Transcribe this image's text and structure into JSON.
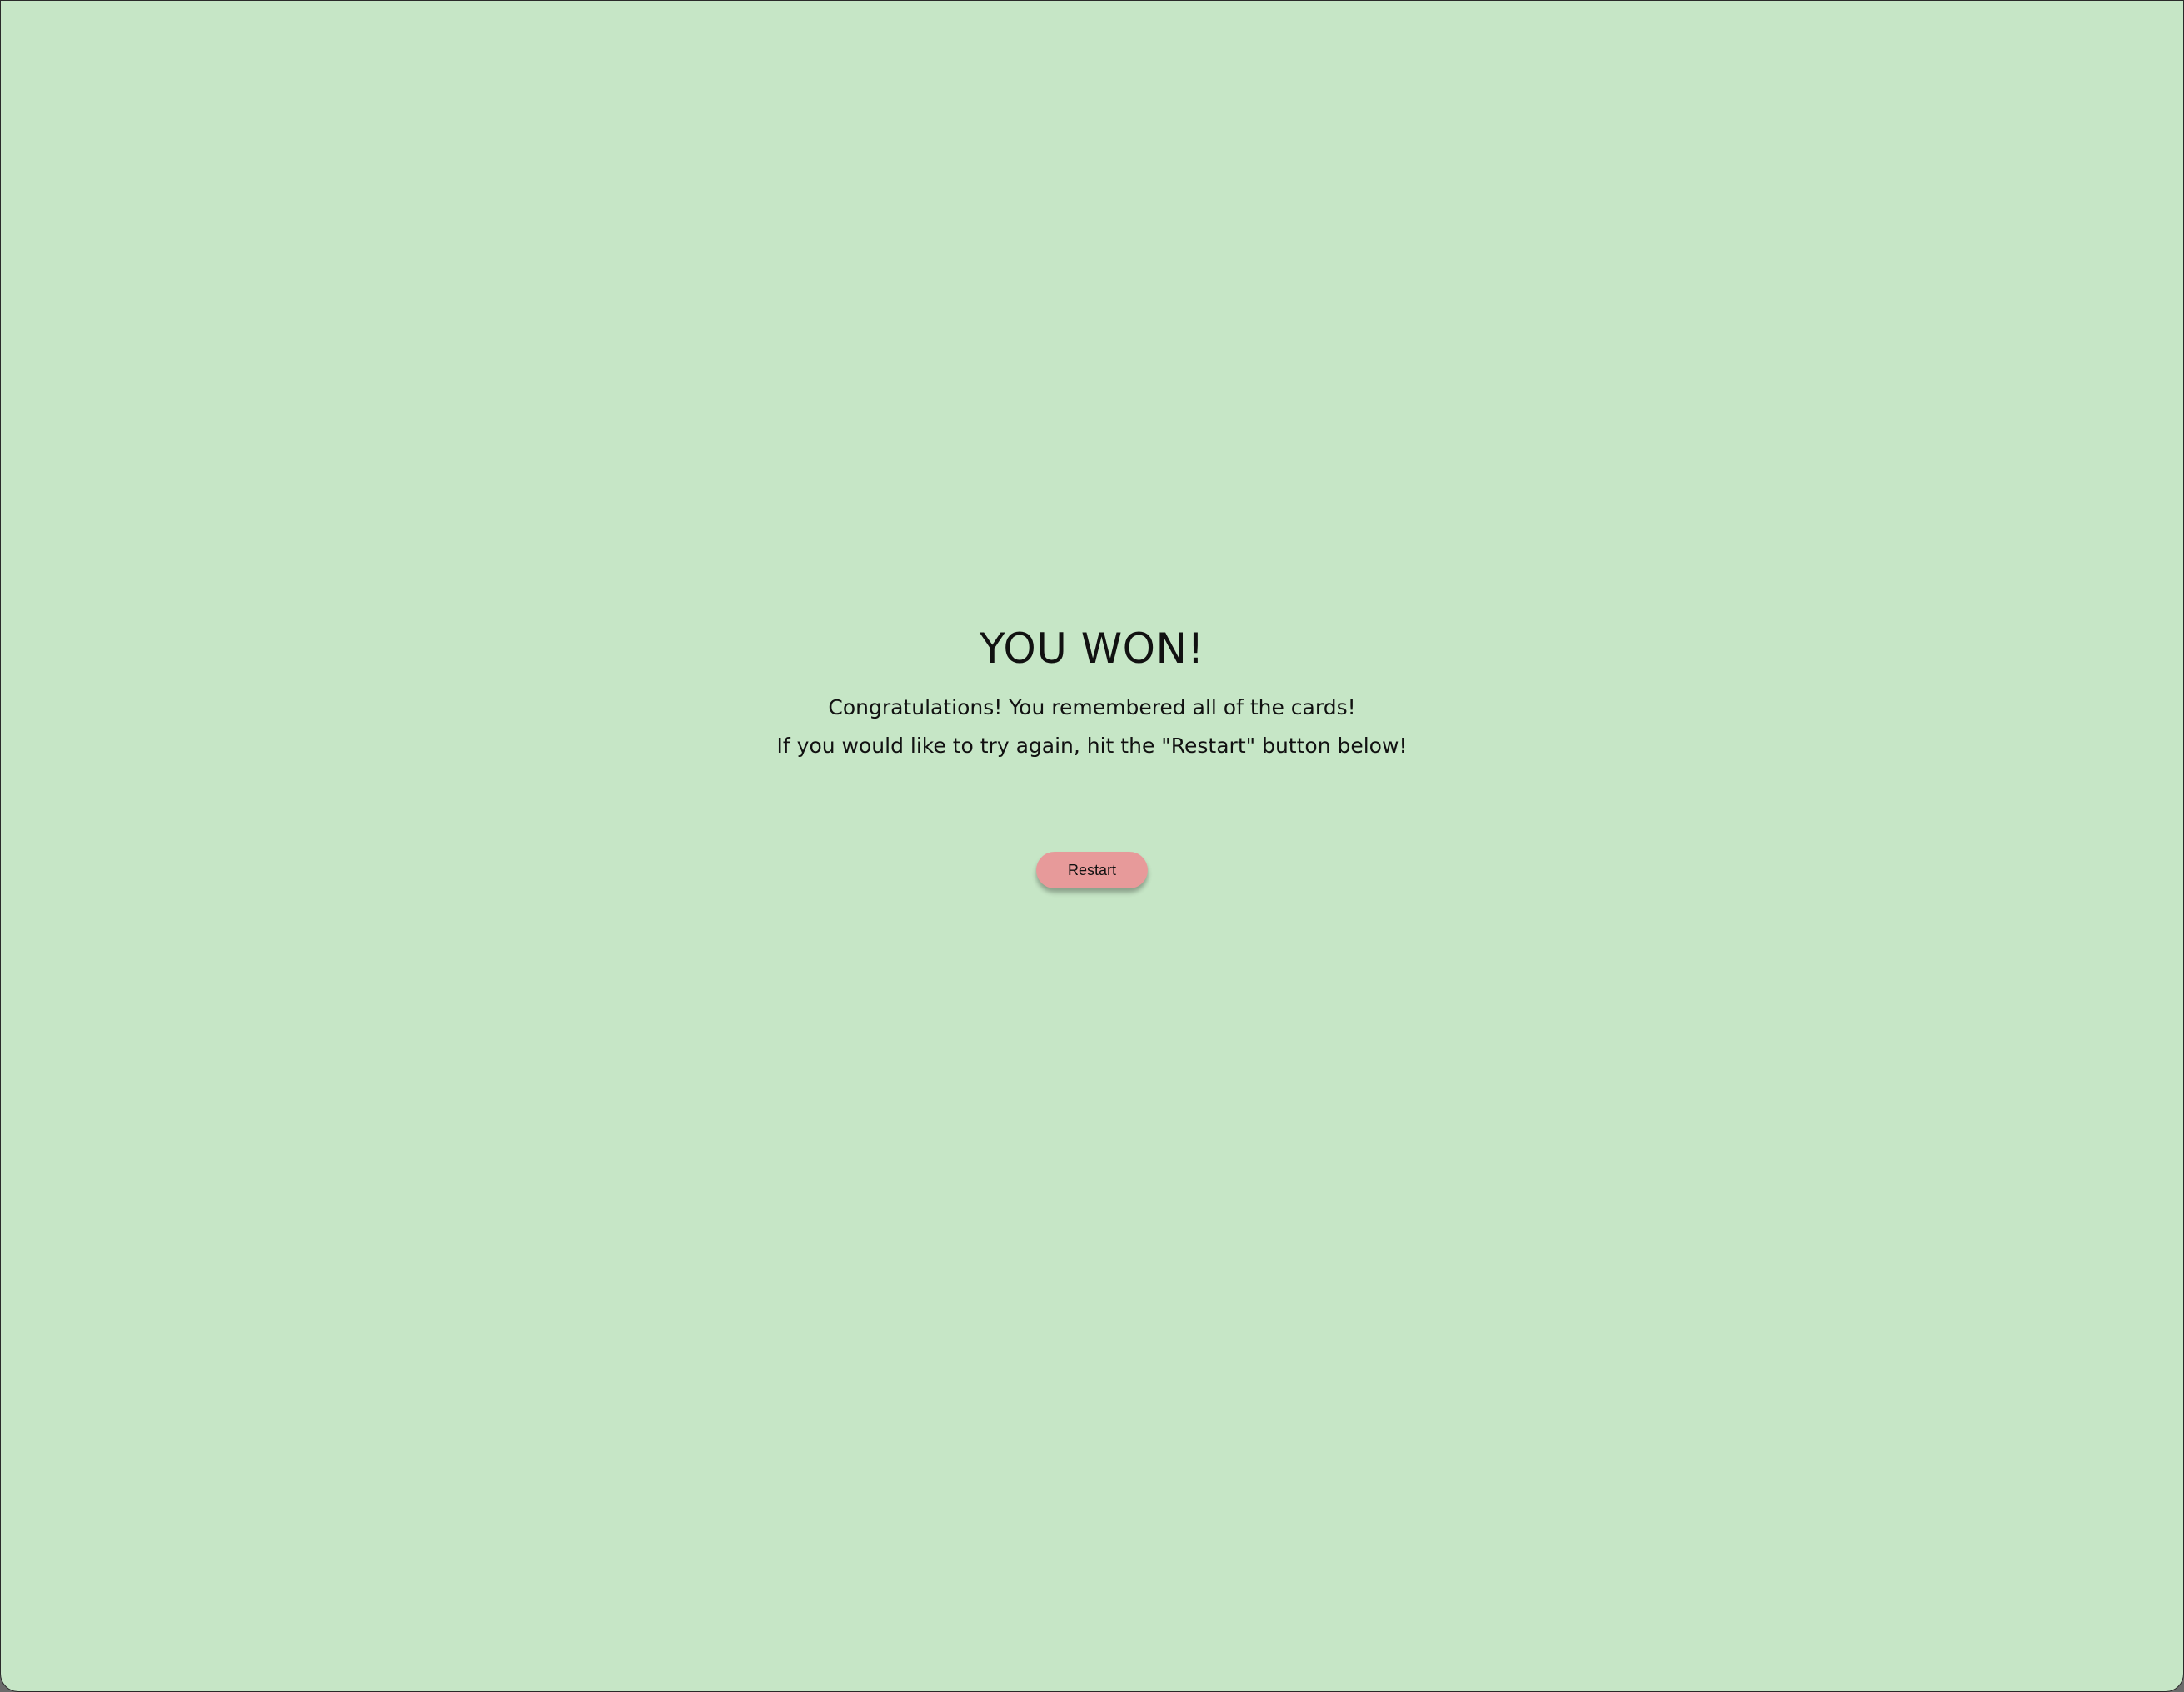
{
  "result": {
    "title": "YOU WON!",
    "message_line1": "Congratulations! You remembered all of the cards!",
    "message_line2": "If you would like to try again, hit the \"Restart\" button below!"
  },
  "actions": {
    "restart_label": "Restart"
  },
  "colors": {
    "background": "#c6e6c6",
    "button": "#e79a9a",
    "text": "#111111"
  }
}
